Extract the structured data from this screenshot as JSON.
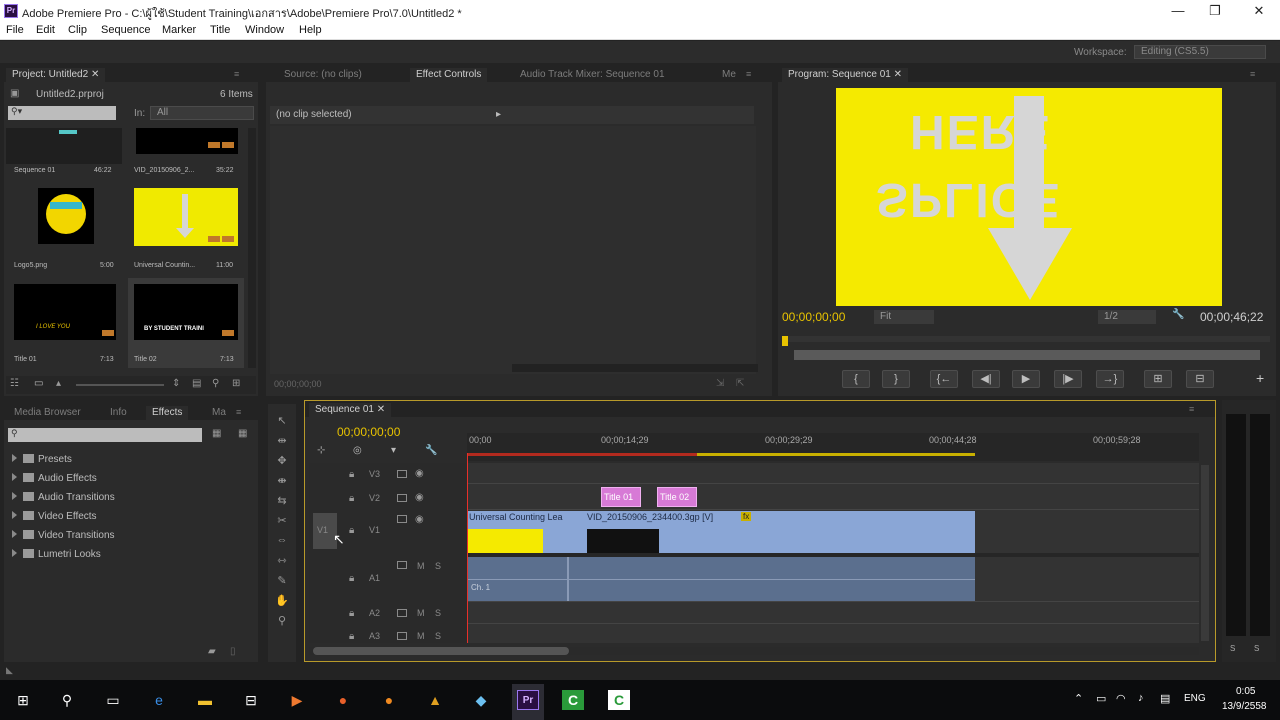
{
  "window": {
    "title": "Adobe Premiere Pro - C:\\ผู้ใช้\\Student Training\\เอกสาร\\Adobe\\Premiere Pro\\7.0\\Untitled2 *",
    "logo_text": "Pr",
    "minimize": "—",
    "restore": "❐",
    "close": "✕"
  },
  "menu": [
    "File",
    "Edit",
    "Clip",
    "Sequence",
    "Marker",
    "Title",
    "Window",
    "Help"
  ],
  "workspace": {
    "label": "Workspace:",
    "value": "Editing (CS5.5)"
  },
  "project": {
    "tabs": [
      "Project: Untitled2",
      "✕"
    ],
    "file": "Untitled2.prproj",
    "count": "6 Items",
    "in_label": "In:",
    "in_value": "All",
    "items": [
      {
        "name": "Sequence 01",
        "dur": "46:22"
      },
      {
        "name": "VID_20150906_2...",
        "dur": "35:22"
      },
      {
        "name": "Logo5.png",
        "dur": "5:00"
      },
      {
        "name": "Universal Countin...",
        "dur": "11:00"
      },
      {
        "name": "Title 01",
        "dur": "7:13"
      },
      {
        "name": "Title 02",
        "dur": "7:13"
      }
    ],
    "title01_text": "I LOVE YOU",
    "title02_text": "BY STUDENT TRAINI"
  },
  "source": {
    "tabs": [
      "Source: (no clips)",
      "Effect Controls",
      "Audio Track Mixer: Sequence 01",
      "Me"
    ],
    "no_clip": "(no clip selected)",
    "timecode": "00;00;00;00"
  },
  "program": {
    "tab": "Program: Sequence 01",
    "frame_text_top": "HERE",
    "frame_text_bottom": "SPLICE",
    "timecode": "00;00;00;00",
    "fit": "Fit",
    "res": "1/2",
    "duration": "00;00;46;22",
    "playhead_fraction": 0,
    "controls": [
      "{",
      "}",
      "{←",
      "◀|",
      "▶",
      "|▶",
      "→}",
      "⊞",
      "⊟",
      "+"
    ],
    "accent": "#f5ea00"
  },
  "effects": {
    "tabs": [
      "Media Browser",
      "Info",
      "Effects",
      "Ma"
    ],
    "folders": [
      "Presets",
      "Audio Effects",
      "Audio Transitions",
      "Video Effects",
      "Video Transitions",
      "Lumetri Looks"
    ]
  },
  "timeline": {
    "tab": "Sequence 01",
    "timecode": "00;00;00;00",
    "ruler": [
      "00;00",
      "00;00;14;29",
      "00;00;29;29",
      "00;00;44;28",
      "00;00;59;28"
    ],
    "tracks": [
      "V3",
      "V2",
      "V1",
      "A1",
      "A2",
      "A3"
    ],
    "source_v1": "V1",
    "m": "M",
    "s": "S",
    "clips": {
      "title01": "Title 01",
      "title02": "Title 02",
      "v1a": "Universal Counting Lea",
      "v1b": "VID_20150906_234400.3gp [V]",
      "fx": "fx",
      "a1_channel": "Ch. 1"
    },
    "colors": {
      "video": "#8aa6d6",
      "title": "#d77ad6",
      "audio": "#5b6f8e",
      "playhead": "#e8302a",
      "timecode": "#e8c300"
    }
  },
  "tools": [
    "↖",
    "⇹",
    "✥",
    "⇼",
    "⇆",
    "✂",
    "⇔",
    "⇿",
    "✎",
    "✋",
    "⚲"
  ],
  "meter": {
    "labels": [
      "S",
      "S"
    ]
  },
  "taskbar": {
    "lang": "ENG",
    "time": "0:05",
    "date": "13/9/2558",
    "icons": [
      "windows-start",
      "search",
      "task-view",
      "edge",
      "file-explorer",
      "store",
      "media-app",
      "firefox",
      "vlc",
      "autocad",
      "app-blue",
      "premiere",
      "camtasia-green",
      "camtasia-white"
    ]
  }
}
